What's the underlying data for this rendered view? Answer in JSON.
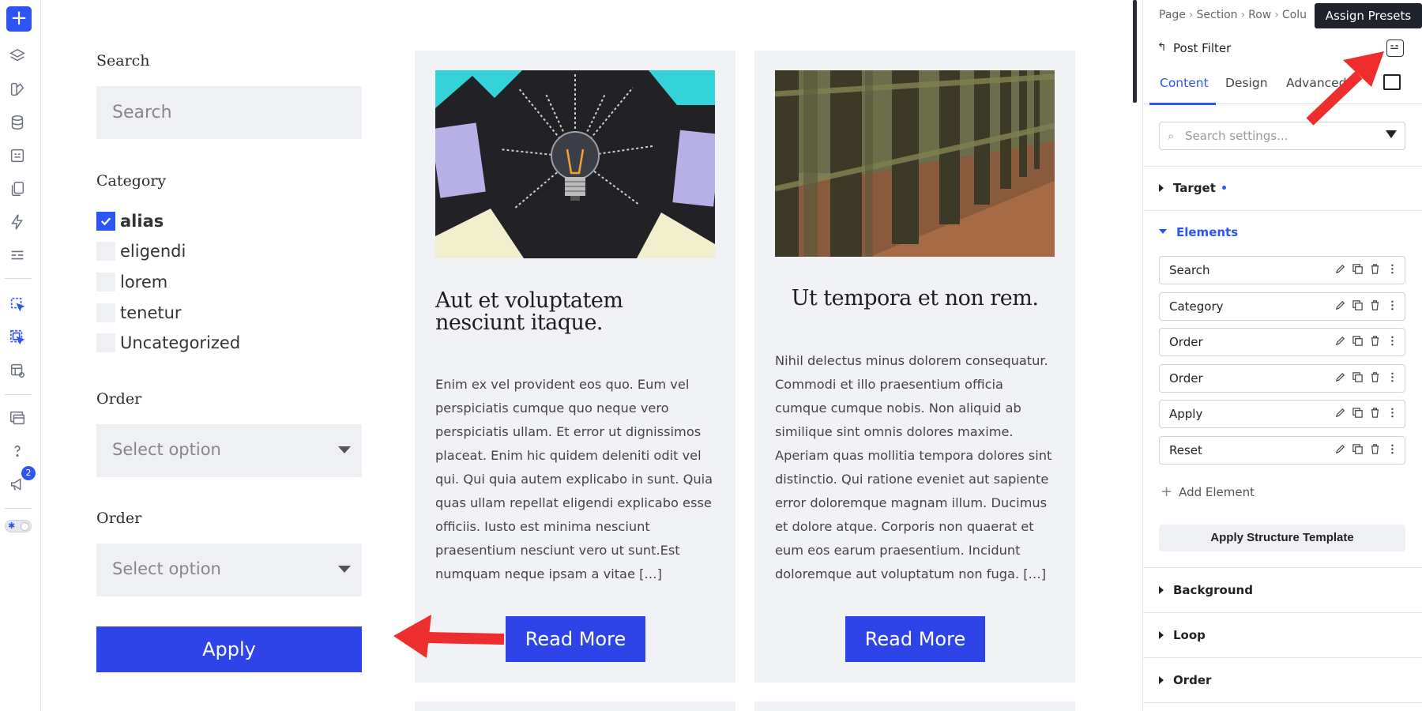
{
  "toolbar": {
    "add_label": "+",
    "icons": [
      "layers-icon",
      "palette-icon",
      "database-icon",
      "preset-icon",
      "pages-icon",
      "lightning-icon",
      "layout-icon",
      "pointer-icon",
      "pointer-multi-icon",
      "template-icon",
      "windows-icon",
      "help-icon",
      "megaphone-icon"
    ],
    "notification_count": "2"
  },
  "filter": {
    "search_label": "Search",
    "search_placeholder": "Search",
    "category_label": "Category",
    "categories": [
      {
        "label": "alias",
        "checked": true
      },
      {
        "label": "eligendi",
        "checked": false
      },
      {
        "label": "lorem",
        "checked": false
      },
      {
        "label": "tenetur",
        "checked": false
      },
      {
        "label": "Uncategorized",
        "checked": false
      }
    ],
    "order1_label": "Order",
    "order1_value": "Select option",
    "order2_label": "Order",
    "order2_value": "Select option",
    "apply_label": "Apply"
  },
  "posts": [
    {
      "title": "Aut et voluptatem nesciunt itaque.",
      "body": "Enim ex vel provident eos quo. Eum vel perspiciatis cumque quo neque vero perspiciatis ullam. Et error ut dignissimos placeat. Enim hic quidem deleniti odit vel qui. Qui quia autem explicabo in sunt. Quia quas ullam repellat eligendi explicabo esse officiis. Iusto est minima nesciunt praesentium nesciunt vero ut sunt.Est numquam neque ipsam a vitae […]",
      "button": "Read More"
    },
    {
      "title": "Ut tempora et non rem.",
      "body": "Nihil delectus minus dolorem consequatur. Commodi et illo praesentium officia cumque cumque nobis. Non aliquid ab similique sint omnis dolores maxime. Aperiam quas mollitia tempora dolores sint distinctio. Qui ratione eveniet aut sapiente error doloremque magnam illum. Ducimus et dolore atque. Corporis non quaerat et eum eos earum praesentium. Incidunt doloremque aut voluptatum non fuga. […]",
      "button": "Read More"
    }
  ],
  "panel": {
    "breadcrumb": [
      "Page",
      "Section",
      "Row",
      "Colu"
    ],
    "tooltip": "Assign Presets",
    "back_icon": "↰",
    "title": "Post Filter",
    "tabs": [
      "Content",
      "Design",
      "Advanced"
    ],
    "active_tab": "Content",
    "search_placeholder": "Search settings...",
    "sections": {
      "target": "Target",
      "elements": "Elements",
      "background": "Background",
      "loop": "Loop",
      "order": "Order"
    },
    "elements": [
      "Search",
      "Category",
      "Order",
      "Order",
      "Apply",
      "Reset"
    ],
    "add_element": "Add Element",
    "apply_structure": "Apply Structure Template"
  },
  "colors": {
    "accent": "#2e55f2",
    "button": "#2e44e8",
    "field_bg": "#eef0f4",
    "card_bg": "#f1f2f6",
    "annotation_arrow": "#ee2d2d"
  }
}
